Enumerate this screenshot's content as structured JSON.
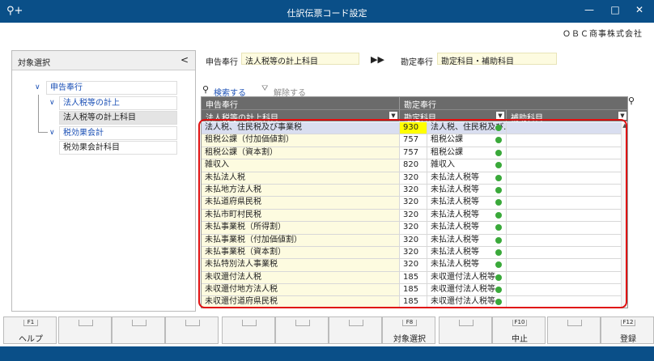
{
  "window": {
    "title": "仕訳伝票コード設定",
    "app_icon": "⚲+",
    "minimize": "—",
    "maximize": "□",
    "close": "✕"
  },
  "company": "ＯＢＣ商事株式会社",
  "left_panel": {
    "header": "対象選択",
    "collapse_glyph": "<",
    "tree": [
      {
        "label": "申告奉行"
      },
      {
        "label": "法人税等の計上"
      },
      {
        "label": "法人税等の計上科目"
      },
      {
        "label": "税効果会計"
      },
      {
        "label": "税効果会計科目"
      }
    ]
  },
  "filters": {
    "source_label": "申告奉行",
    "source_value": "法人税等の計上科目",
    "arrow": "▶▶",
    "target_label": "勘定奉行",
    "target_value": "勘定科目・補助科目"
  },
  "search": {
    "search_link": "検索する",
    "clear_link": "解除する"
  },
  "grid": {
    "group_headers": [
      "申告奉行",
      "勘定奉行"
    ],
    "columns": [
      "法人税等の計上科目",
      "勘定科目",
      "補助科目"
    ],
    "rows": [
      {
        "name": "法人税、住民税及び事業税",
        "code": "930",
        "account": "法人税、住民税及び…",
        "selected": true
      },
      {
        "name": "租税公課（付加価値割）",
        "code": "757",
        "account": "租税公課"
      },
      {
        "name": "租税公課（資本割）",
        "code": "757",
        "account": "租税公課"
      },
      {
        "name": "雑収入",
        "code": "820",
        "account": "雑収入"
      },
      {
        "name": "未払法人税",
        "code": "320",
        "account": "未払法人税等"
      },
      {
        "name": "未払地方法人税",
        "code": "320",
        "account": "未払法人税等"
      },
      {
        "name": "未払道府県民税",
        "code": "320",
        "account": "未払法人税等"
      },
      {
        "name": "未払市町村民税",
        "code": "320",
        "account": "未払法人税等"
      },
      {
        "name": "未払事業税（所得割）",
        "code": "320",
        "account": "未払法人税等"
      },
      {
        "name": "未払事業税（付加価値割）",
        "code": "320",
        "account": "未払法人税等"
      },
      {
        "name": "未払事業税（資本割）",
        "code": "320",
        "account": "未払法人税等"
      },
      {
        "name": "未払特別法人事業税",
        "code": "320",
        "account": "未払法人税等"
      },
      {
        "name": "未収還付法人税",
        "code": "185",
        "account": "未収還付法人税等"
      },
      {
        "name": "未収還付地方法人税",
        "code": "185",
        "account": "未収還付法人税等"
      },
      {
        "name": "未収還付道府県民税",
        "code": "185",
        "account": "未収還付法人税等"
      }
    ]
  },
  "fkeys": [
    {
      "key": "F1",
      "label": "ヘルプ"
    },
    {
      "key": "",
      "label": ""
    },
    {
      "key": "",
      "label": ""
    },
    {
      "key": "",
      "label": ""
    },
    {
      "key": "",
      "label": ""
    },
    {
      "key": "",
      "label": ""
    },
    {
      "key": "",
      "label": ""
    },
    {
      "key": "F8",
      "label": "対象選択"
    },
    {
      "key": "",
      "label": ""
    },
    {
      "key": "F10",
      "label": "中止"
    },
    {
      "key": "",
      "label": ""
    },
    {
      "key": "F12",
      "label": "登録"
    }
  ],
  "colors": {
    "titlebar": "#0a4f88",
    "highlight": "#e01010",
    "selected_code": "#ffff00",
    "check": "#3aa93a"
  }
}
